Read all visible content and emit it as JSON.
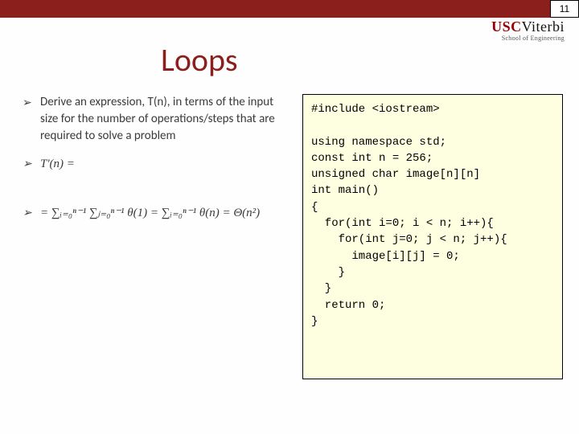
{
  "page_number": "11",
  "logo": {
    "usc": "USC",
    "viterbi": "Viterbi",
    "sub": "School of Engineering"
  },
  "title": "Loops",
  "bullets": [
    "Derive an expression, T(n), in terms of the input size for the number of operations/steps that are required to solve a problem",
    "T'(n) =",
    "= ∑ᵢ₌₀ⁿ⁻¹ ∑ⱼ₌₀ⁿ⁻¹ θ(1) = ∑ᵢ₌₀ⁿ⁻¹ θ(n) = Θ(n²)"
  ],
  "code": "#include <iostream>\n\nusing namespace std;\nconst int n = 256;\nunsigned char image[n][n]\nint main()\n{\n  for(int i=0; i < n; i++){\n    for(int j=0; j < n; j++){\n      image[i][j] = 0;\n    }\n  }\n  return 0;\n}"
}
